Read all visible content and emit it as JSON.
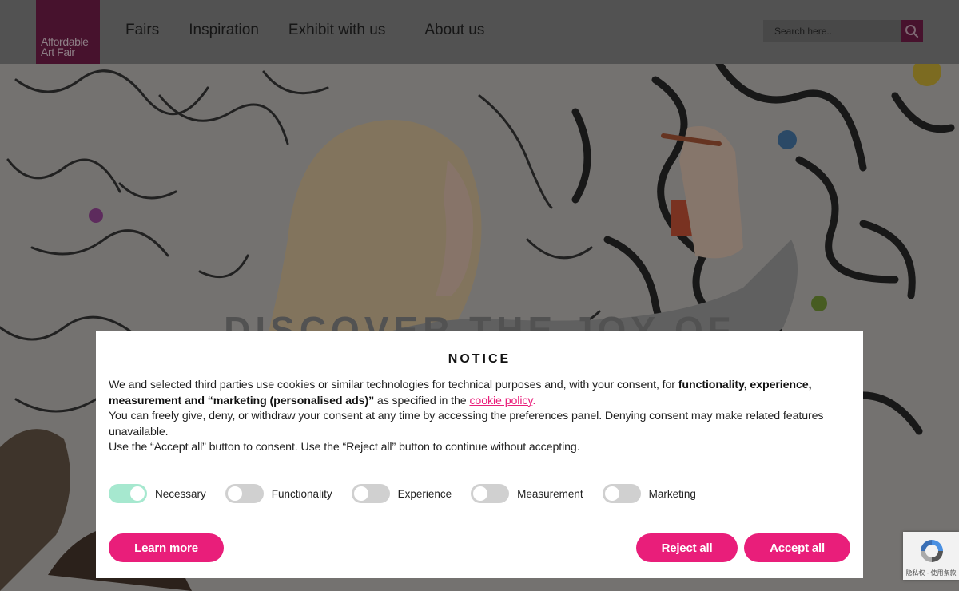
{
  "brand": {
    "logo_line1": "Affordable",
    "logo_line2": "Art Fair",
    "accent_color": "#e91e7a",
    "logo_color": "#c91f6c"
  },
  "nav": {
    "items": [
      {
        "label": "Fairs"
      },
      {
        "label": "Inspiration"
      },
      {
        "label": "Exhibit with us"
      },
      {
        "label": "About us"
      }
    ]
  },
  "search": {
    "placeholder": "Search here..",
    "icon": "search-icon"
  },
  "hero": {
    "title": "DISCOVER THE JOY OF"
  },
  "cookie_notice": {
    "title": "NOTICE",
    "para1_start": "We and selected third parties use cookies or similar technologies for technical purposes and, with your consent, for ",
    "para1_bold": "functionality, experience, measurement and “marketing (personalised ads)”",
    "para1_mid": " as specified in the ",
    "para1_link": "cookie policy",
    "para1_end": ".",
    "para2": "You can freely give, deny, or withdraw your consent at any time by accessing the preferences panel. Denying consent may make related features unavailable.",
    "para3": "Use the “Accept all” button to consent. Use the “Reject all” button to continue without accepting.",
    "toggles": [
      {
        "label": "Necessary",
        "on": true
      },
      {
        "label": "Functionality",
        "on": false
      },
      {
        "label": "Experience",
        "on": false
      },
      {
        "label": "Measurement",
        "on": false
      },
      {
        "label": "Marketing",
        "on": false
      }
    ],
    "learn_more_label": "Learn more",
    "reject_label": "Reject all",
    "accept_label": "Accept all",
    "toggle_on_color": "#a6e8cf"
  },
  "recaptcha": {
    "text": "隐私权 - 使用条款"
  }
}
